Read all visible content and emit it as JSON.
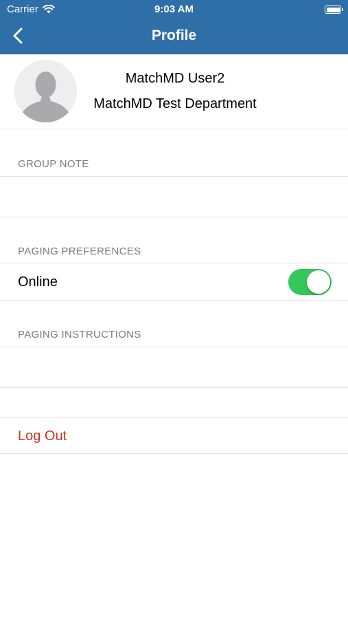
{
  "status_bar": {
    "carrier": "Carrier",
    "time": "9:03 AM"
  },
  "nav": {
    "title": "Profile"
  },
  "profile": {
    "name": "MatchMD User2",
    "department": "MatchMD Test Department"
  },
  "sections": {
    "group_note": "GROUP NOTE",
    "paging_preferences": "PAGING PREFERENCES",
    "paging_instructions": "PAGING INSTRUCTIONS"
  },
  "online": {
    "label": "Online",
    "enabled": true
  },
  "actions": {
    "logout": "Log Out"
  },
  "colors": {
    "nav_bar": "#2e6fa7",
    "toggle_on": "#34c759",
    "logout_text": "#d0321f",
    "section_header": "#7a7a7f"
  }
}
